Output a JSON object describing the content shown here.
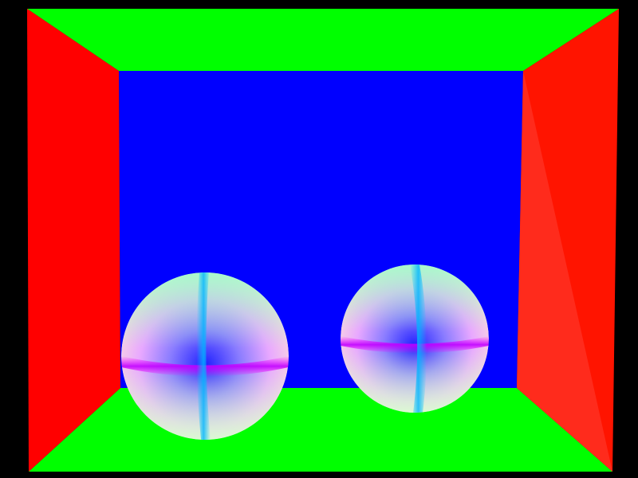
{
  "scene": {
    "background": "#000000",
    "colors": {
      "ceiling": "#00ff00",
      "floor": "#00ff00",
      "left_wall": "#ff0000",
      "right_wall": "#ff1400",
      "right_wall_highlight": "#ff2b1c",
      "back_wall": "#0000ff",
      "sphere_center": "#0000ff",
      "sphere_horizontal_band": "#ff00ff",
      "sphere_vertical_band": "#00c8ff",
      "sphere_top_tint": "#66ff99",
      "sphere_bottom_tint": "#ccffcc"
    }
  }
}
